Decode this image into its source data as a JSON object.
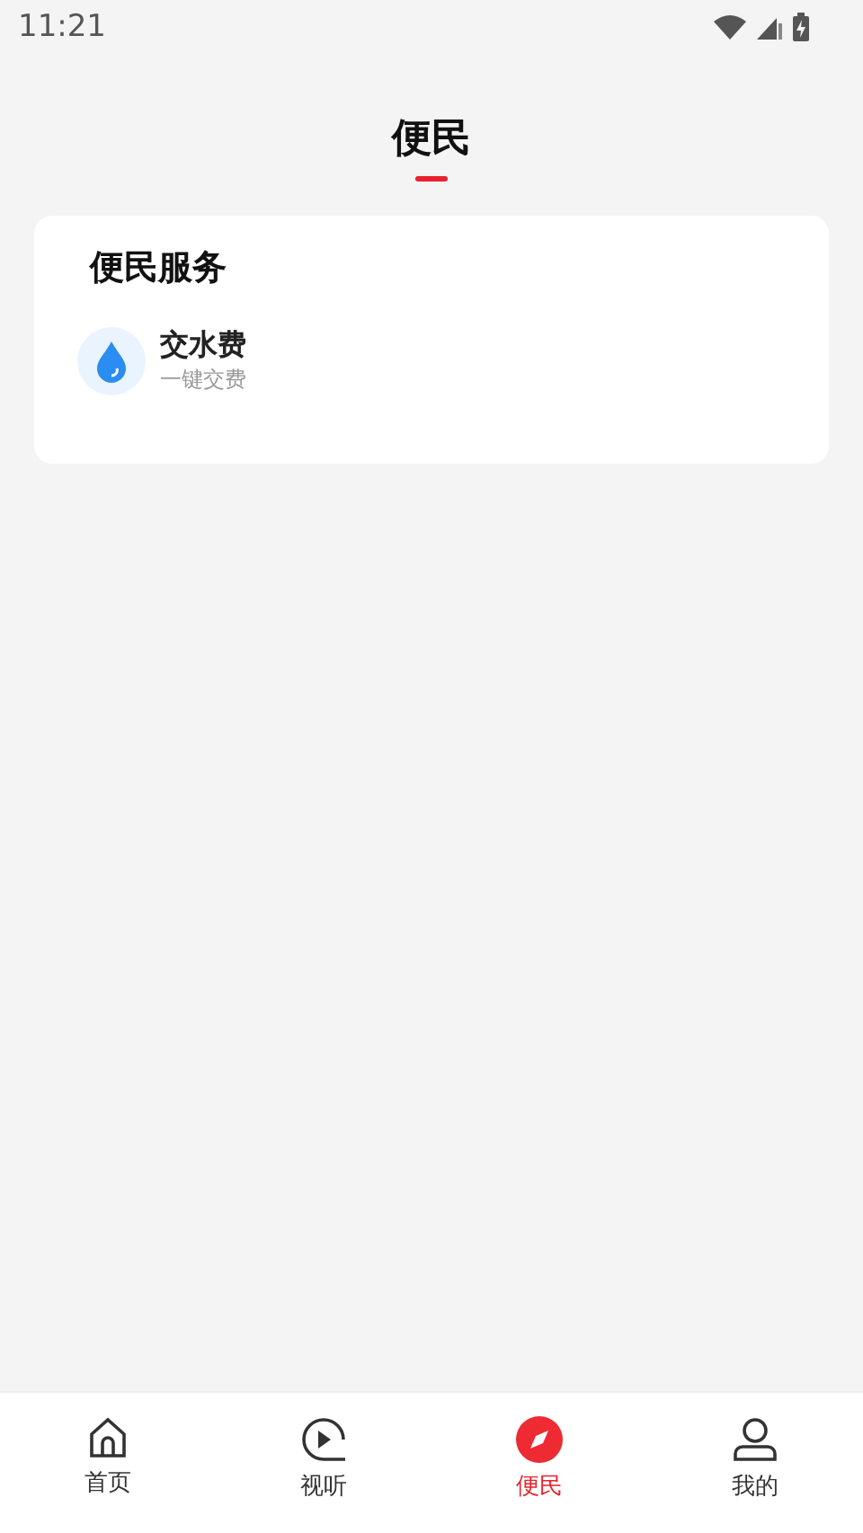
{
  "status_bar": {
    "time": "11:21"
  },
  "header": {
    "title": "便民"
  },
  "section": {
    "title": "便民服务",
    "services": [
      {
        "name": "交水费",
        "subtitle": "一键交费"
      }
    ]
  },
  "tab_bar": [
    {
      "label": "首页",
      "selected": false
    },
    {
      "label": "视听",
      "selected": false
    },
    {
      "label": "便民",
      "selected": true
    },
    {
      "label": "我的",
      "selected": false
    }
  ]
}
